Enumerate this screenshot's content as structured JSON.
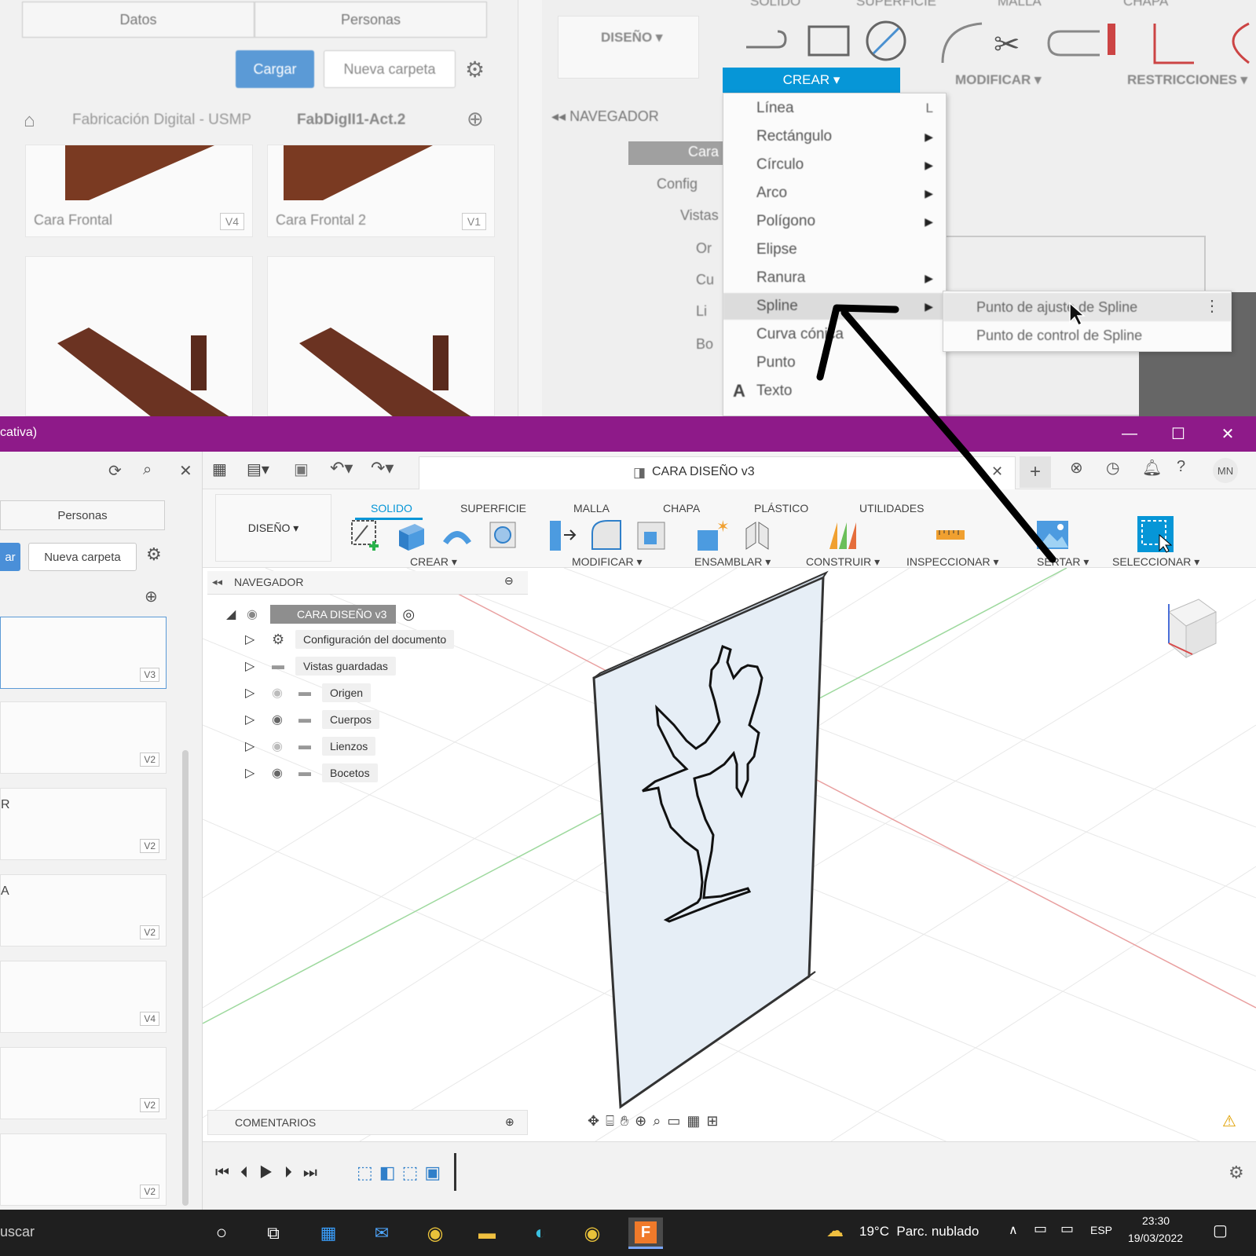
{
  "top": {
    "tabs": [
      "Datos",
      "Personas"
    ],
    "upload_label": "Cargar",
    "new_folder_label": "Nueva carpeta",
    "breadcrumb_root": "Fabricación Digital - USMP",
    "breadcrumb_current": "FabDigII1-Act.2",
    "cards": [
      {
        "name": "Cara Frontal",
        "version": "V4"
      },
      {
        "name": "Cara Frontal 2",
        "version": "V1"
      }
    ],
    "ribbon_header": "SÓLIDO",
    "ribbon_superficie": "SUPERFICIE",
    "ribbon_malla": "MALLA",
    "ribbon_chapa": "CHAPA",
    "design_label": "DISEÑO",
    "crear_label": "CREAR",
    "modificar_label": "MODIFICAR",
    "restricciones_label": "RESTRICCIONES",
    "navigator_label": "NAVEGADOR",
    "nav_rows": [
      "Cara",
      "Config",
      "Vistas",
      "Or",
      "Cu",
      "Li",
      "Bo"
    ],
    "menu_items": [
      {
        "label": "Línea",
        "shortcut": "L",
        "submenu": false
      },
      {
        "label": "Rectángulo",
        "submenu": true
      },
      {
        "label": "Círculo",
        "submenu": true
      },
      {
        "label": "Arco",
        "submenu": true
      },
      {
        "label": "Polígono",
        "submenu": true
      },
      {
        "label": "Elipse",
        "submenu": false
      },
      {
        "label": "Ranura",
        "submenu": true
      },
      {
        "label": "Spline",
        "submenu": true
      },
      {
        "label": "Curva cónica",
        "submenu": false
      },
      {
        "label": "Punto",
        "submenu": false
      },
      {
        "label": "Texto",
        "submenu": false
      }
    ],
    "submenu_items": [
      "Punto de ajuste de Spline",
      "Punto de control de Spline"
    ]
  },
  "window": {
    "title_fragment": "cativa)",
    "doc_title": "CARA DISEÑO v3",
    "user_initials": "MN"
  },
  "left_panel": {
    "tab": "Personas",
    "upload_fragment": "ar",
    "new_folder": "Nueva carpeta",
    "cards": [
      {
        "letter": "",
        "version": "V3"
      },
      {
        "letter": "",
        "version": "V2"
      },
      {
        "letter": "R",
        "version": "V2"
      },
      {
        "letter": "A",
        "version": "V2"
      },
      {
        "letter": "",
        "version": "V4"
      },
      {
        "letter": "",
        "version": "V2"
      },
      {
        "letter": "",
        "version": "V2"
      }
    ]
  },
  "ribbon": {
    "tabs": [
      "SOLIDO",
      "SUPERFICIE",
      "MALLA",
      "CHAPA",
      "PLÁSTICO",
      "UTILIDADES"
    ],
    "active_tab": "SOLIDO",
    "design": "DISEÑO",
    "groups": [
      "CREAR",
      "MODIFICAR",
      "ENSAMBLAR",
      "CONSTRUIR",
      "INSPECCIONAR",
      "SERTAR",
      "SELECCIONAR"
    ]
  },
  "browser": {
    "header": "NAVEGADOR",
    "root": "CARA DISEÑO v3",
    "items": [
      "Configuración del documento",
      "Vistas guardadas",
      "Origen",
      "Cuerpos",
      "Lienzos",
      "Bocetos"
    ]
  },
  "comments_label": "COMENTARIOS",
  "taskbar": {
    "search_fragment": "uscar",
    "weather": "19°C  Parc. nublado",
    "lang": "ESP",
    "time": "23:30",
    "date": "19/03/2022"
  },
  "colors": {
    "titlebar": "#8e1a89",
    "accent_blue": "#0696d7",
    "upload_blue": "#4a8fd8"
  }
}
